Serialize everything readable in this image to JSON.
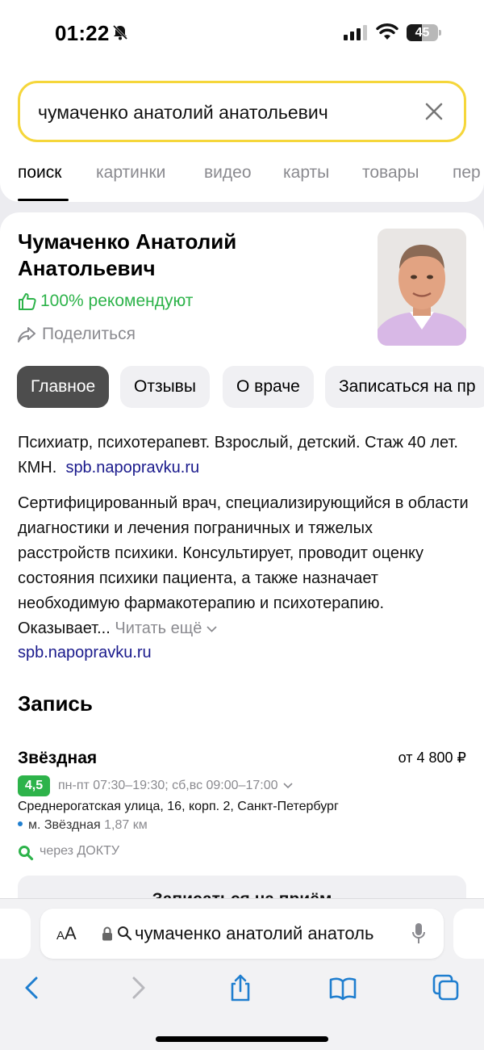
{
  "status": {
    "time": "01:22",
    "battery": "45"
  },
  "search": {
    "query": "чумаченко анатолий анатольевич"
  },
  "tabs": [
    {
      "label": "поиск"
    },
    {
      "label": "картинки"
    },
    {
      "label": "видео"
    },
    {
      "label": "карты"
    },
    {
      "label": "товары"
    },
    {
      "label": "пер"
    }
  ],
  "doctor": {
    "name_line1": "Чумаченко Анатолий",
    "name_line2": "Анатольевич",
    "recommend": "100% рекомендуют",
    "share": "Поделиться"
  },
  "pills": [
    {
      "label": "Главное"
    },
    {
      "label": "Отзывы"
    },
    {
      "label": "О враче"
    },
    {
      "label": "Записаться на пр"
    }
  ],
  "summary": {
    "text": "Психиатр, психотерапевт. Взрослый, детский. Стаж 40 лет. КМН.",
    "source": "spb.napopravku.ru"
  },
  "description": {
    "text": "Сертифицированный врач, специализирующийся в области диагностики и лечения пограничных и тяжелых расстройств психики. Консультирует, проводит оценку состояния психики пациента, а также назначает необходимую фармакотерапию и психотерапию. Оказывает...",
    "more": "Читать ещё",
    "source": "spb.napopravku.ru"
  },
  "booking": {
    "title": "Запись",
    "clinic": "Звёздная",
    "price": "от 4 800 ₽",
    "rating": "4,5",
    "hours": "пн-пт 07:30–19:30; сб,вс 09:00–17:00",
    "address": "Среднерогатская улица, 16, корп. 2, Санкт-Петербург",
    "metro": "м. Звёздная",
    "distance": "1,87 км",
    "via": "через ДОКТУ",
    "button": "Записаться на приём"
  },
  "browser": {
    "url_text": "чумаченко анатолий анатоль"
  },
  "colors": {
    "accent_yellow": "#f5d63a",
    "green": "#2db34a",
    "link": "#1a1a8c"
  }
}
